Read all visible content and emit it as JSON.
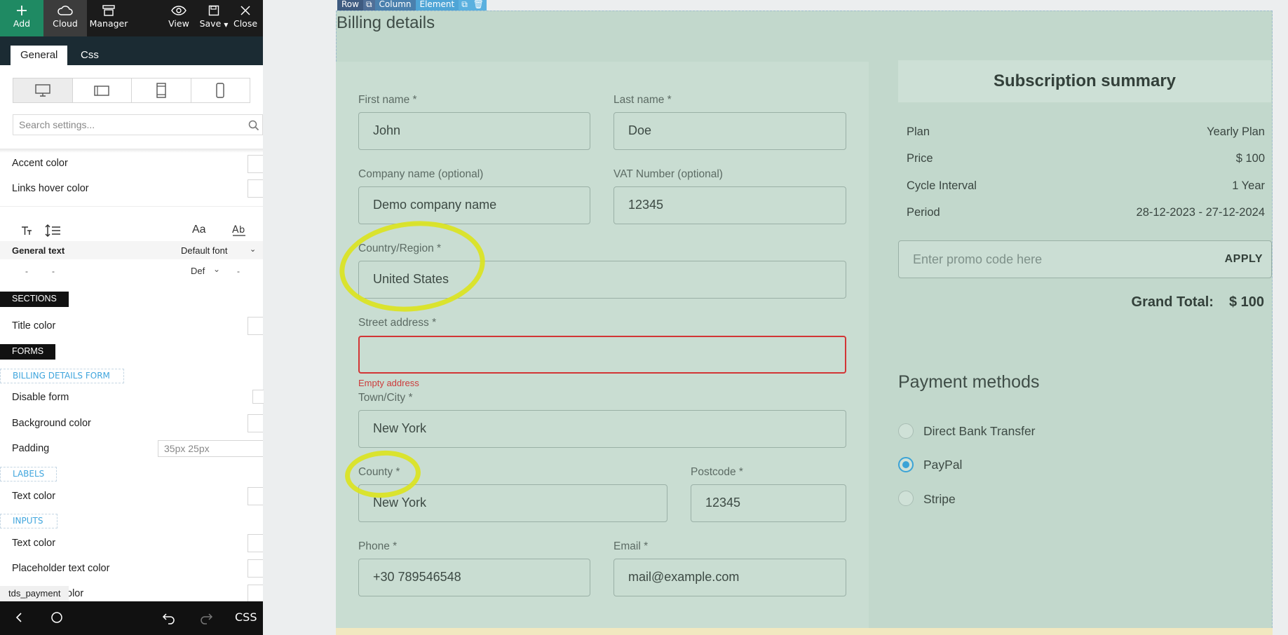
{
  "toolbar": {
    "add": "Add",
    "cloud": "Cloud",
    "manager": "Manager",
    "view": "View",
    "save": "Save",
    "close": "Close"
  },
  "tabs": {
    "general": "General",
    "css": "Css"
  },
  "search": {
    "placeholder": "Search settings..."
  },
  "settings": {
    "accent_color": "Accent color",
    "links_hover_color": "Links hover color",
    "general_text": "General text",
    "default_font": "Default font",
    "def_short": "Def",
    "dash": "-",
    "sections_header": "SECTIONS",
    "title_color": "Title color",
    "forms_header": "FORMS",
    "billing_form_header": "BILLING DETAILS FORM",
    "disable_form": "Disable form",
    "background_color": "Background color",
    "padding_label": "Padding",
    "padding_value": "35px 25px",
    "labels_header": "LABELS",
    "labels_text_color": "Text color",
    "inputs_header": "INPUTS",
    "inputs_text_color": "Text color",
    "placeholder_text_color": "Placeholder text color",
    "partial_row": "olor"
  },
  "status_label": "tds_payment",
  "bottom_bar": {
    "css": "CSS"
  },
  "element_toolbar": {
    "row": "Row",
    "column": "Column",
    "element": "Element"
  },
  "billing": {
    "title": "Billing details",
    "first_name_label": "First name *",
    "first_name": "John",
    "last_name_label": "Last name *",
    "last_name": "Doe",
    "company_label": "Company name (optional)",
    "company": "Demo company name",
    "vat_label": "VAT Number (optional)",
    "vat": "12345",
    "country_label": "Country/Region *",
    "country": "United States",
    "street_label": "Street address *",
    "street": "",
    "street_error": "Empty address",
    "city_label": "Town/City *",
    "city": "New York",
    "county_label": "County *",
    "county": "New York",
    "postcode_label": "Postcode *",
    "postcode": "12345",
    "phone_label": "Phone *",
    "phone": "+30 789546548",
    "email_label": "Email *",
    "email": "mail@example.com"
  },
  "summary": {
    "title": "Subscription summary",
    "rows": [
      {
        "label": "Plan",
        "value": "Yearly Plan"
      },
      {
        "label": "Price",
        "value": "$ 100"
      },
      {
        "label": "Cycle Interval",
        "value": "1 Year"
      },
      {
        "label": "Period",
        "value": "28-12-2023 - 27-12-2024"
      }
    ],
    "promo_placeholder": "Enter promo code here",
    "apply": "APPLY",
    "grand_total_label": "Grand Total:",
    "grand_total_value": "$ 100"
  },
  "payment": {
    "title": "Payment methods",
    "methods": [
      {
        "label": "Direct Bank Transfer",
        "selected": false
      },
      {
        "label": "PayPal",
        "selected": true
      },
      {
        "label": "Stripe",
        "selected": false
      }
    ]
  },
  "colors": {
    "canvas_bg": "#c2d8cc",
    "accent_green": "#1f8a63",
    "highlight": "#dbe320",
    "error_red": "#d23535",
    "radio_blue": "#3ba3d6"
  }
}
